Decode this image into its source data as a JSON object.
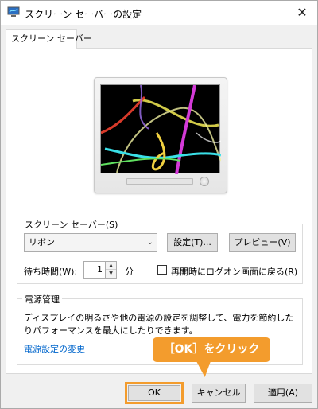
{
  "window": {
    "title": "スクリーン セーバーの設定",
    "close_glyph": "✕"
  },
  "tab": {
    "label": "スクリーン セーバー"
  },
  "screensaver_group": {
    "label": "スクリーン セーバー(S)",
    "selected": "リボン",
    "settings_button": "設定(T)...",
    "preview_button": "プレビュー(V)",
    "wait_label": "待ち時間(W):",
    "wait_value": "1",
    "wait_unit": "分",
    "resume_logon_label": "再開時にログオン画面に戻る(R)",
    "resume_logon_checked": false
  },
  "power_group": {
    "label": "電源管理",
    "description_line1": "ディスプレイの明るさや他の電源の設定を調整して、電力を節約した",
    "description_line2": "りパフォーマンスを最大にしたりできます。",
    "link": "電源設定の変更"
  },
  "callout": {
    "text": "［OK］をクリック",
    "color": "#f39c2d"
  },
  "buttons": {
    "ok": "OK",
    "cancel": "キャンセル",
    "apply": "適用(A)"
  },
  "icons": {
    "app": "monitor-screensaver-icon",
    "dropdown": "chevron-down-icon",
    "spin_up": "triangle-up-icon",
    "spin_down": "triangle-down-icon"
  }
}
